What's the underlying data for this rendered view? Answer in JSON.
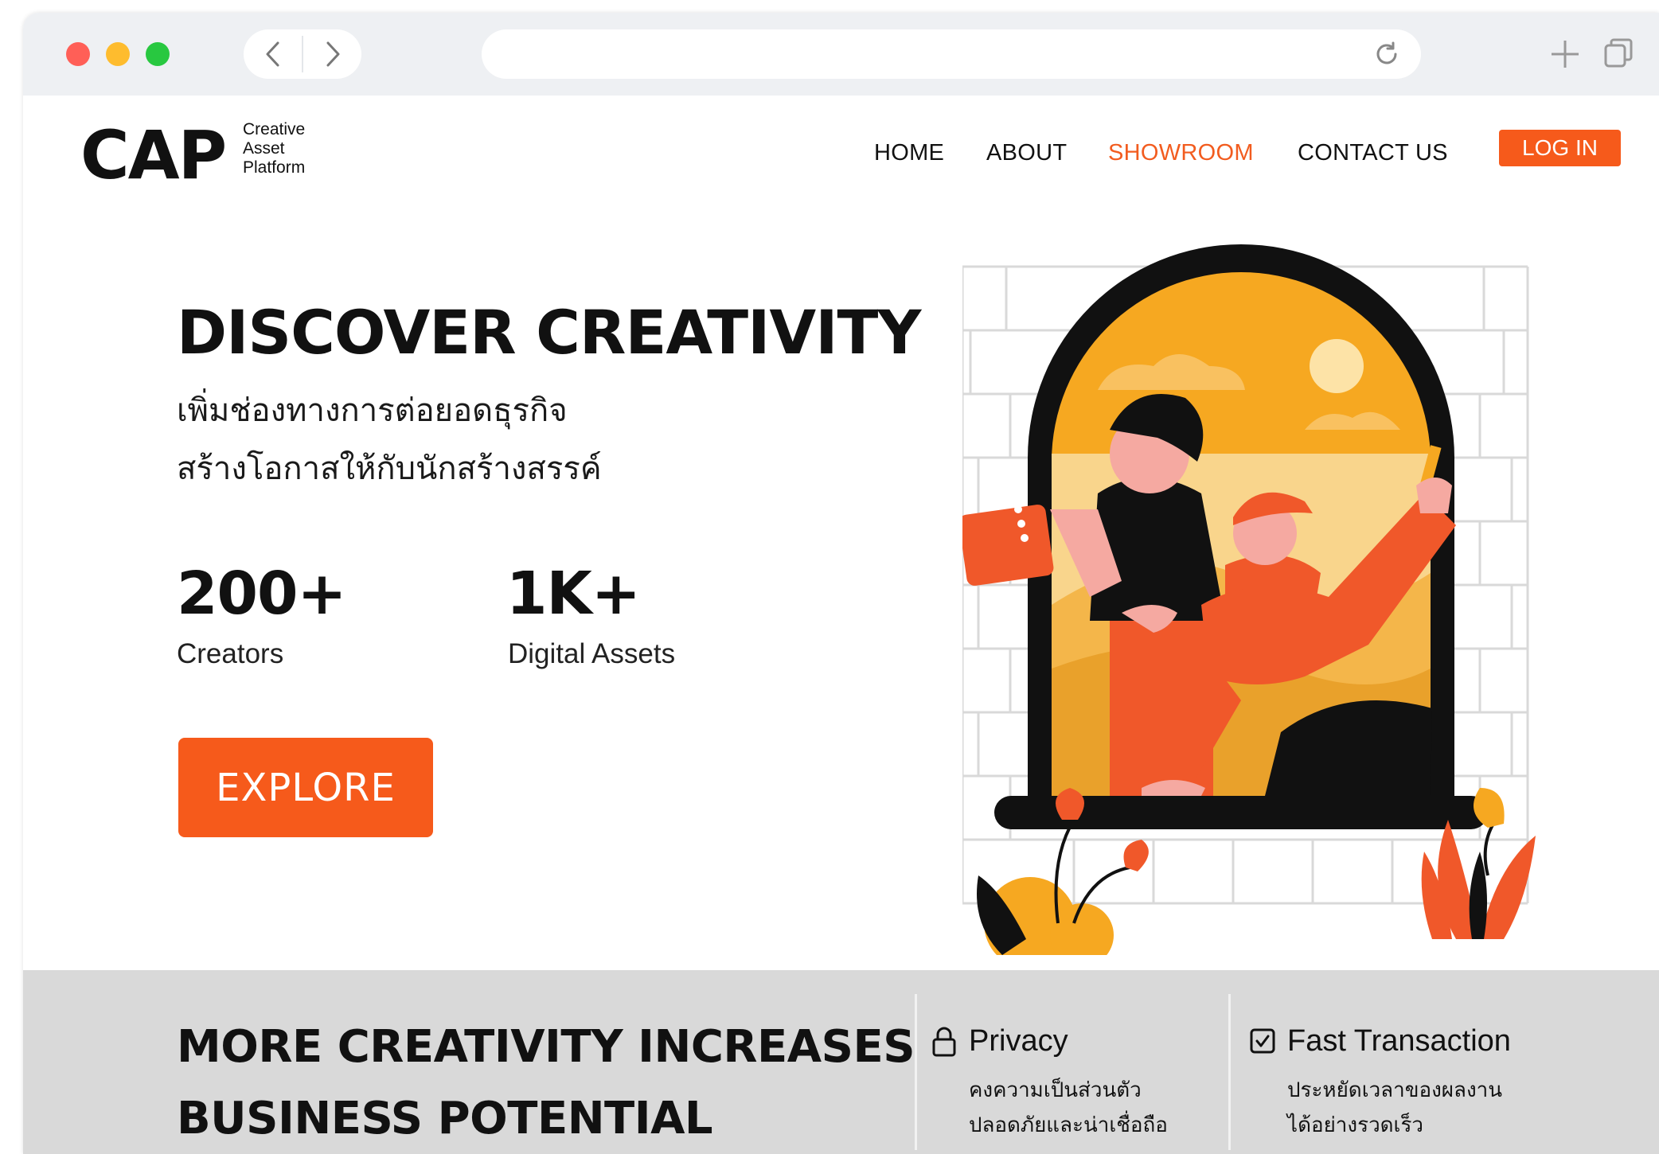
{
  "brand": {
    "mark": "CAP",
    "tagline": [
      "Creative",
      "Asset",
      "Platform"
    ]
  },
  "nav": {
    "items": [
      "HOME",
      "ABOUT",
      "SHOWROOM",
      "CONTACT US"
    ],
    "active": "SHOWROOM",
    "login_label": "LOG IN"
  },
  "hero": {
    "title": "DISCOVER CREATIVITY",
    "subtitle_lines": [
      "เพิ่มช่องทางการต่อยอดธุรกิจ",
      "สร้างโอกาสให้กับนักสร้างสรรค์"
    ],
    "stats": [
      {
        "value": "200+",
        "label": "Creators"
      },
      {
        "value": "1K+",
        "label": "Digital Assets"
      }
    ],
    "cta_label": "EXPLORE"
  },
  "band": {
    "title_lines": [
      "MORE CREATIVITY INCREASES",
      "BUSINESS POTENTIAL"
    ],
    "features": [
      {
        "icon": "lock-icon",
        "name": "Privacy",
        "lines": [
          "คงความเป็นส่วนตัว",
          "ปลอดภัยและน่าเชื่อถือ"
        ]
      },
      {
        "icon": "checkbox-icon",
        "name": "Fast Transaction",
        "lines": [
          "ประหยัดเวลาของผลงาน",
          "ได้อย่างรวดเร็ว"
        ]
      }
    ]
  },
  "colors": {
    "accent": "#f65a1b",
    "active_nav": "#f25c1f",
    "band_bg": "#d9d9d9",
    "chrome_bg": "#eef0f3"
  }
}
